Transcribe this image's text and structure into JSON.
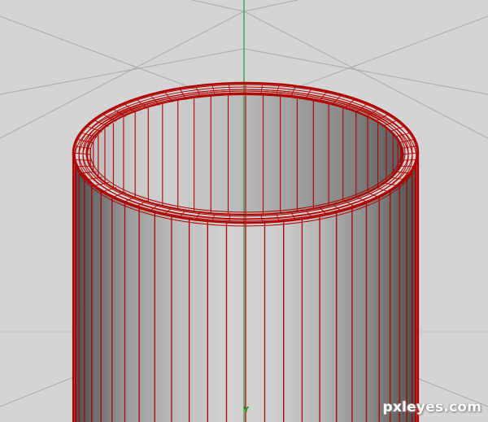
{
  "viewport": {
    "background": "#d4d4d4",
    "grid_color": "#a9a9a9",
    "axis_color": "#2a9a2a",
    "wireframe_color": "#b00000"
  },
  "axis_label": "Y",
  "watermark": "pxleyes.com"
}
